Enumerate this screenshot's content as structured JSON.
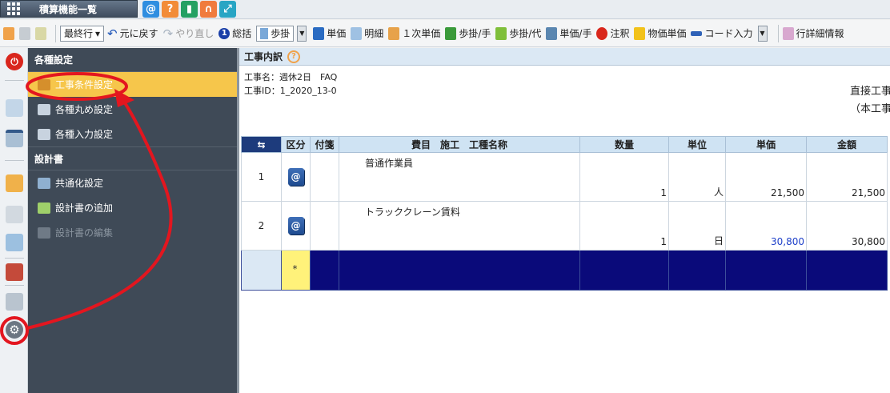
{
  "topbar": {
    "menu_label": "積算機能一覧",
    "icons": [
      {
        "name": "at-icon",
        "color": "#2f8ee0",
        "glyph": "@"
      },
      {
        "name": "help-icon",
        "color": "#f28c38",
        "glyph": "?"
      },
      {
        "name": "bookmark-icon",
        "color": "#23a063",
        "glyph": "▮"
      },
      {
        "name": "headset-icon",
        "color": "#f07b3d",
        "glyph": "∩"
      },
      {
        "name": "expand-icon",
        "color": "#28a5c4",
        "glyph": "⤢"
      }
    ]
  },
  "toolbar": {
    "final_row_select": "最終行",
    "undo_label": "元に戻す",
    "redo_label": "やり直し",
    "summary_label": "総括",
    "rate_select": "歩掛",
    "unit_price_label": "単価",
    "detail_label": "明細",
    "primary_unit_price_label": "１次単価",
    "rate_hand_label": "歩掛/手",
    "rate_substitute_label": "歩掛/代",
    "unit_price_hand_label": "単価/手",
    "annotation_label": "注釈",
    "material_unit_price_label": "物価単価",
    "code_input_label": "コード入力",
    "row_detail_label": "行詳細情報"
  },
  "panel": {
    "section1_title": "各種設定",
    "items1": [
      {
        "label": "工事条件設定"
      },
      {
        "label": "各種丸め設定"
      },
      {
        "label": "各種入力設定"
      }
    ],
    "section2_title": "設計書",
    "items2": [
      {
        "label": "共通化設定"
      },
      {
        "label": "設計書の追加"
      },
      {
        "label": "設計書の編集"
      }
    ]
  },
  "main": {
    "title": "工事内訳",
    "project_name": "工事名：週休2日　FAQ",
    "project_id": "工事ID：1_2020_13-0",
    "right_line1": "直接工事",
    "right_line2": "（本工事",
    "columns": {
      "category": "区分",
      "note": "付箋",
      "item": "費目　施工　工種名称",
      "quantity": "数量",
      "unit": "単位",
      "unit_price": "単価",
      "amount": "金額"
    },
    "rows": [
      {
        "no": "1",
        "name": "普通作業員",
        "quantity": "1",
        "unit": "人",
        "unit_price": "21,500",
        "amount": "21,500"
      },
      {
        "no": "2",
        "name": "トラッククレーン賃料",
        "quantity": "1",
        "unit": "日",
        "unit_price": "30,800",
        "amount": "30,800"
      }
    ],
    "new_row_marker": "*"
  },
  "colors": {
    "panel_bg": "#3f4a57",
    "active_item": "#f6c64b",
    "header_blue": "#cfe3f3",
    "new_row_navy": "#0a0a7a",
    "annotation_red": "#e3161f"
  }
}
